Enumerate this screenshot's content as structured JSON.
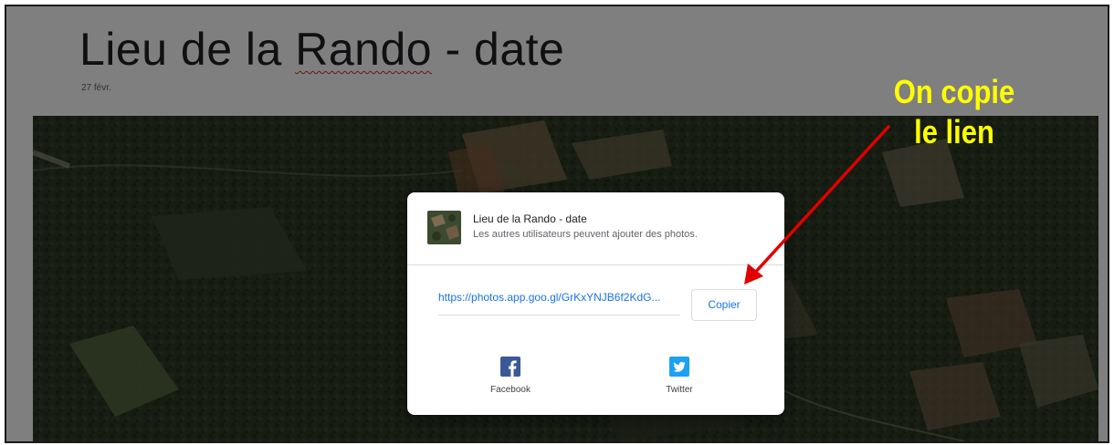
{
  "album": {
    "title_part1": "Lieu de la ",
    "title_misspelled": "Rando",
    "title_part2": " - date",
    "date": "27 févr."
  },
  "share_dialog": {
    "title": "Lieu de la Rando - date",
    "subtitle": "Les autres utilisateurs peuvent ajouter des photos.",
    "link": "https://photos.app.goo.gl/GrKxYNJB6f2KdG...",
    "copy_label": "Copier",
    "facebook_label": "Facebook",
    "twitter_label": "Twitter"
  },
  "annotation": {
    "line1": "On copie",
    "line2": "le lien",
    "text_color": "#ffff00",
    "arrow_color": "#e00000"
  },
  "icons": {
    "facebook": "facebook-icon",
    "twitter": "twitter-icon"
  },
  "colors": {
    "link": "#1a73e8",
    "facebook": "#3b5998",
    "twitter": "#1da1f2"
  }
}
